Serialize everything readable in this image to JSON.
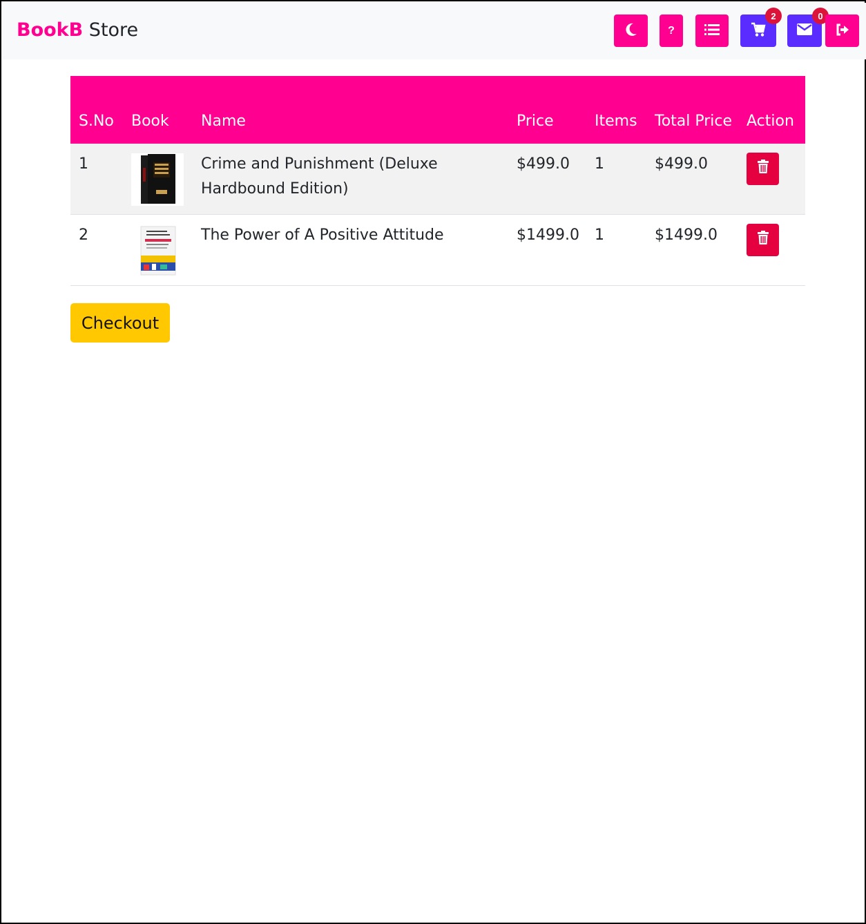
{
  "navbar": {
    "brand_bold": "BookB",
    "brand_rest": " Store",
    "buttons": [
      {
        "icon": "moon-icon"
      },
      {
        "icon": "question-icon",
        "label": "?"
      },
      {
        "icon": "list-icon"
      },
      {
        "icon": "cart-icon",
        "badge": "2"
      },
      {
        "icon": "envelope-icon",
        "badge": "0"
      },
      {
        "icon": "sign-out-icon"
      }
    ]
  },
  "table": {
    "headers": [
      "S.No",
      "Book",
      "Name",
      "Price",
      "Items",
      "Total Price",
      "Action"
    ],
    "rows": [
      {
        "sno": "1",
        "name": "Crime and Punishment (Deluxe Hardbound Edition)",
        "price": "$499.0",
        "items": "1",
        "total": "$499.0"
      },
      {
        "sno": "2",
        "name": "The Power of A Positive Attitude",
        "price": "$1499.0",
        "items": "1",
        "total": "$1499.0"
      }
    ]
  },
  "checkout_label": "Checkout",
  "colors": {
    "brand": "#ff0090",
    "accent_purple": "#5b2cff",
    "danger": "#e5003f",
    "checkout": "#ffc800"
  }
}
